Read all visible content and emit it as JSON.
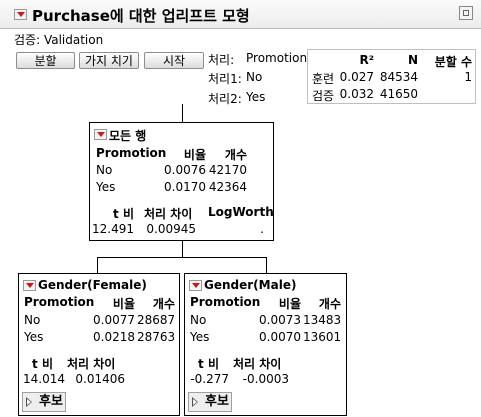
{
  "title": "Purchase에 대한 업리프트 모형",
  "validation": "검증: Validation",
  "buttons": {
    "split": "분할",
    "prune": "가지 치기",
    "go": "시작"
  },
  "treatment": {
    "label": "처리:",
    "value": "Promotion",
    "t1_label": "처리1:",
    "t1_value": "No",
    "t2_label": "처리2:",
    "t2_value": "Yes"
  },
  "stats": {
    "headers": [
      "R²",
      "N",
      "분할 수"
    ],
    "rows": [
      {
        "label": "훈련",
        "r2": "0.027",
        "n": "84534",
        "splits": "1"
      },
      {
        "label": "검증",
        "r2": "0.032",
        "n": "41650",
        "splits": ""
      }
    ]
  },
  "root": {
    "title": "모든 행",
    "headers": [
      "Promotion",
      "비율",
      "개수"
    ],
    "rows": [
      {
        "level": "No",
        "rate": "0.0076",
        "count": "42170"
      },
      {
        "level": "Yes",
        "rate": "0.0170",
        "count": "42364"
      }
    ],
    "stat_headers": [
      "t 비",
      "처리 차이",
      "LogWorth"
    ],
    "stat_values": [
      "12.491",
      "0.00945",
      "."
    ]
  },
  "left": {
    "title": "Gender(Female)",
    "headers": [
      "Promotion",
      "비율",
      "개수"
    ],
    "rows": [
      {
        "level": "No",
        "rate": "0.0077",
        "count": "28687"
      },
      {
        "level": "Yes",
        "rate": "0.0218",
        "count": "28763"
      }
    ],
    "stat_headers": [
      "t 비",
      "처리 차이"
    ],
    "stat_values": [
      "14.014",
      "0.01406"
    ],
    "candidates": "후보"
  },
  "right": {
    "title": "Gender(Male)",
    "headers": [
      "Promotion",
      "비율",
      "개수"
    ],
    "rows": [
      {
        "level": "No",
        "rate": "0.0073",
        "count": "13483"
      },
      {
        "level": "Yes",
        "rate": "0.0070",
        "count": "13601"
      }
    ],
    "stat_headers": [
      "t 비",
      "처리 차이"
    ],
    "stat_values": [
      "-0.277",
      "-0.0003"
    ],
    "candidates": "후보"
  }
}
